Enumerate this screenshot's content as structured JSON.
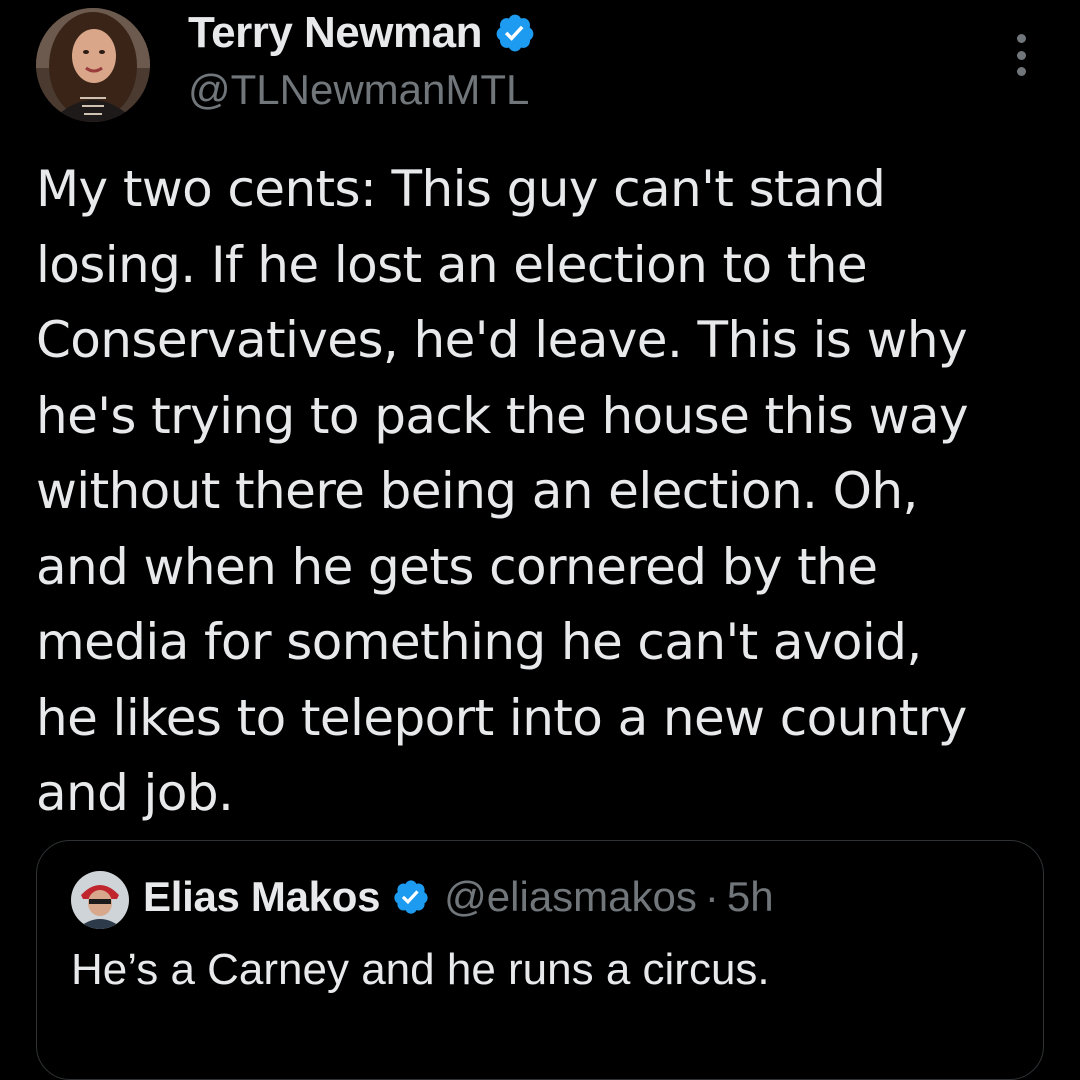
{
  "tweet": {
    "author_name": "Terry Newman",
    "author_handle": "@TLNewmanMTL",
    "verified_icon": "verified-badge-icon",
    "more_icon": "more-options-icon",
    "text": "My two cents: This guy can't stand\nlosing. If he lost an election to the\nConservatives, he'd leave. This is why\nhe's trying to pack the house this way\nwithout there being an election. Oh,\nand when he gets cornered by the\nmedia for something he can't avoid,\nhe likes to teleport into a new country\nand job."
  },
  "quoted_tweet": {
    "author_name": "Elias Makos",
    "author_handle": "@eliasmakos",
    "separator": "·",
    "time": "5h",
    "text": "He’s a Carney and he runs a circus."
  },
  "colors": {
    "background": "#000000",
    "primary_text": "#e7e9ea",
    "secondary_text": "#71767b",
    "verified_blue": "#1d9bf0",
    "border": "#2f3336"
  }
}
